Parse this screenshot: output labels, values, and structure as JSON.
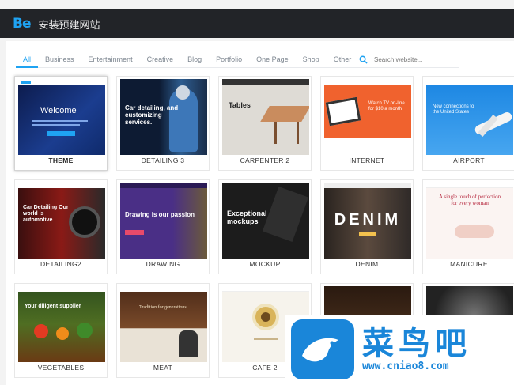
{
  "app": {
    "logo": "Be",
    "title": "安装预建网站"
  },
  "tabs": [
    {
      "label": "All"
    },
    {
      "label": "Business"
    },
    {
      "label": "Entertainment"
    },
    {
      "label": "Creative"
    },
    {
      "label": "Blog"
    },
    {
      "label": "Portfolio"
    },
    {
      "label": "One Page"
    },
    {
      "label": "Shop"
    },
    {
      "label": "Other"
    }
  ],
  "search": {
    "placeholder": "Search website..."
  },
  "sites": [
    {
      "label": "THEME",
      "headline": "Welcome"
    },
    {
      "label": "DETAILING 3",
      "headline": "Car detailing, and customizing services."
    },
    {
      "label": "CARPENTER 2",
      "headline": "Tables"
    },
    {
      "label": "INTERNET",
      "headline": "Watch TV on-line for $10 a month"
    },
    {
      "label": "AIRPORT",
      "headline": "New connections to the United States"
    },
    {
      "label": "DETAILING2",
      "headline": "Car Detailing Our world is automotive"
    },
    {
      "label": "DRAWING",
      "headline": "Drawing is our passion"
    },
    {
      "label": "MOCKUP",
      "headline": "Exceptional mockups"
    },
    {
      "label": "DENIM",
      "headline": "DENIM"
    },
    {
      "label": "MANICURE",
      "headline": "A single touch of perfection for every woman"
    },
    {
      "label": "VEGETABLES",
      "headline": "Your diligent supplier"
    },
    {
      "label": "MEAT",
      "headline": "Tradition for generations"
    },
    {
      "label": "CAFE 2",
      "headline": ""
    },
    {
      "label": "",
      "headline": ""
    },
    {
      "label": "",
      "headline": ""
    }
  ],
  "watermark": {
    "brand": "菜鸟吧",
    "url": "www.cniao8.com"
  },
  "colors": {
    "accent": "#1fa3f2",
    "titlebar": "#222428",
    "watermark": "#1a86d9"
  }
}
